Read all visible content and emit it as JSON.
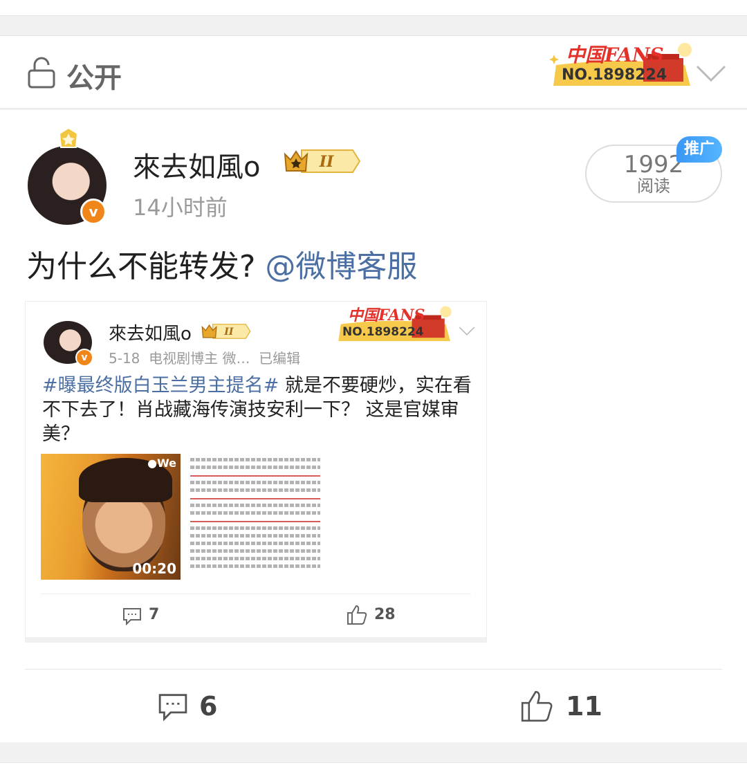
{
  "visibility": {
    "label": "公开"
  },
  "fans_badge": {
    "line1": "中国FANS",
    "line2": "NO.1898224"
  },
  "post": {
    "author": "來去如風o",
    "level": "II",
    "verified_mark": "v",
    "time": "14小时前",
    "reads": {
      "count": "1992",
      "label": "阅读"
    },
    "promo_tag": "推广",
    "text": "为什么不能转发?",
    "mention": "@微博客服",
    "comments": "6",
    "likes": "11"
  },
  "repost": {
    "author": "來去如風o",
    "level": "II",
    "verified_mark": "v",
    "meta_date": "5-18",
    "meta_role": "电视剧博主 微…",
    "meta_edited": "已编辑",
    "hashtag": "#曝最终版白玉兰男主提名#",
    "text": " 就是不要硬炒，实在看不下去了！肖战藏海传演技安利一下？ 这是官媒审美？",
    "video_duration": "00:20",
    "video_watermark": "●We",
    "comments": "7",
    "likes": "28"
  },
  "colors": {
    "link": "#4b6fa3",
    "verified": "#f08519",
    "promo": "#3a97f5",
    "badge_red": "#e4322b"
  },
  "icons": [
    "lock-icon",
    "chevron-down-icon",
    "crown-icon",
    "comment-icon",
    "thumbs-up-icon"
  ]
}
